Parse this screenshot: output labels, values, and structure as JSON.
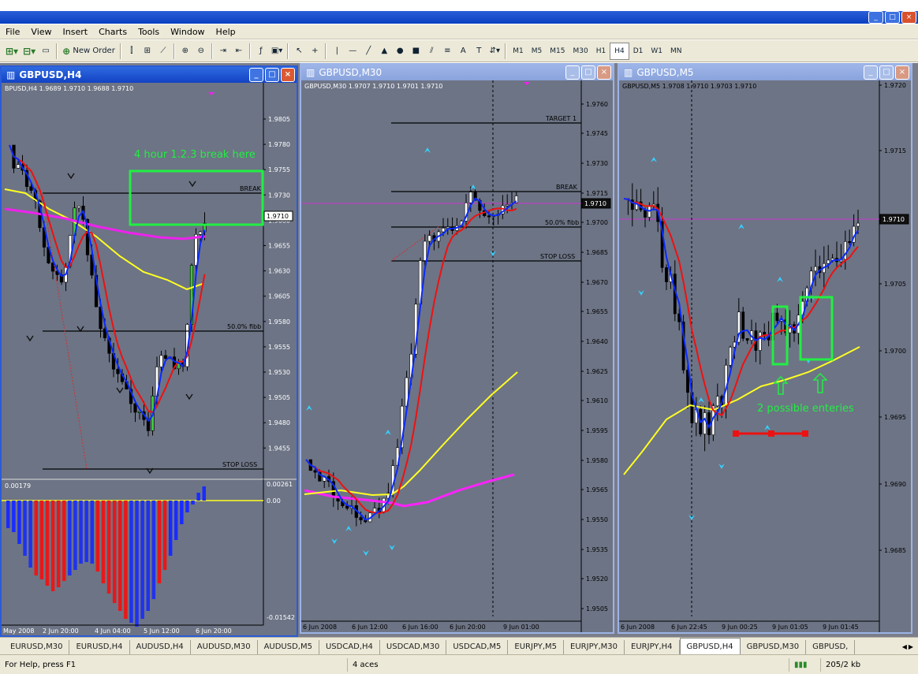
{
  "menu": [
    "File",
    "View",
    "Insert",
    "Charts",
    "Tools",
    "Window",
    "Help"
  ],
  "toolbar": {
    "new_order": "New Order",
    "text_tool": "A",
    "timeframes": [
      "M1",
      "M5",
      "M15",
      "M30",
      "H1",
      "H4",
      "D1",
      "W1",
      "MN"
    ],
    "active_timeframe": "H4"
  },
  "windows": {
    "h4": {
      "title": "GBPUSD,H4",
      "info": "BPUSD,H4  1.9689 1.9710 1.9688 1.9710",
      "annotation": "4 hour 1.2.3 break here",
      "level_labels": {
        "break": "BREAK",
        "fibb": "50.0% fibb",
        "stop": "STOP LOSS"
      },
      "price_ticks": [
        "1.9805",
        "1.9780",
        "1.9755",
        "1.9730",
        "1.9710",
        "1.9680",
        "1.9655",
        "1.9630",
        "1.9605",
        "1.9580",
        "1.9555",
        "1.9530",
        "1.9505",
        "1.9480",
        "1.9455"
      ],
      "current_price": "1.9710",
      "indicator": {
        "label": "0.00179",
        "ticks": [
          "0.00261",
          "0.00",
          "-0.01542"
        ]
      },
      "time_ticks": [
        "May 2008",
        "2 Jun 20:00",
        "4 Jun 04:00",
        "5 Jun 12:00",
        "6 Jun 20:00"
      ]
    },
    "m30": {
      "title": "GBPUSD,M30",
      "info": "GBPUSD,M30  1.9707 1.9710 1.9701 1.9710",
      "level_labels": {
        "target": "TARGET 1",
        "break": "BREAK",
        "fibb": "50.0% fibb",
        "stop": "STOP LOSS"
      },
      "price_ticks": [
        "1.9760",
        "1.9745",
        "1.9730",
        "1.9715",
        "1.9710",
        "1.9700",
        "1.9685",
        "1.9670",
        "1.9655",
        "1.9640",
        "1.9625",
        "1.9610",
        "1.9595",
        "1.9580",
        "1.9565",
        "1.9550",
        "1.9535",
        "1.9520",
        "1.9505"
      ],
      "current_price": "1.9710",
      "time_ticks": [
        "6 Jun 2008",
        "6 Jun 12:00",
        "6 Jun 16:00",
        "6 Jun 20:00",
        "9 Jun 01:00"
      ]
    },
    "m5": {
      "title": "GBPUSD,M5",
      "info": "GBPUSD,M5  1.9708 1.9710 1.9703 1.9710",
      "annotation": "2 possible enteries",
      "price_ticks": [
        "1.9720",
        "1.9715",
        "1.9710",
        "1.9705",
        "1.9700",
        "1.9695",
        "1.9690",
        "1.9685"
      ],
      "current_price": "1.9710",
      "time_ticks": [
        "6 Jun 2008",
        "6 Jun 22:45",
        "9 Jun 00:25",
        "9 Jun 01:05",
        "9 Jun 01:45"
      ]
    }
  },
  "tabs": [
    "EURUSD,M30",
    "EURUSD,H4",
    "AUDUSD,H4",
    "AUDUSD,M30",
    "AUDUSD,M5",
    "USDCAD,H4",
    "USDCAD,M30",
    "USDCAD,M5",
    "EURJPY,M5",
    "EURJPY,M30",
    "EURJPY,H4",
    "GBPUSD,H4",
    "GBPUSD,M30",
    "GBPUSD,"
  ],
  "active_tab": "GBPUSD,H4",
  "status": {
    "help": "For Help, press F1",
    "profile": "4 aces",
    "traffic": "205/2 kb"
  },
  "colors": {
    "chart_bg": "#6d7485",
    "bull": "#ffffff",
    "green_bar": "#3ec43e",
    "red_ma": "#ee1111",
    "blue_ma": "#0a2aff",
    "yellow_ma": "#ffff22",
    "magenta_ma": "#ee22ee",
    "annotation": "#22ee44",
    "arrow": "#35d0ff"
  }
}
